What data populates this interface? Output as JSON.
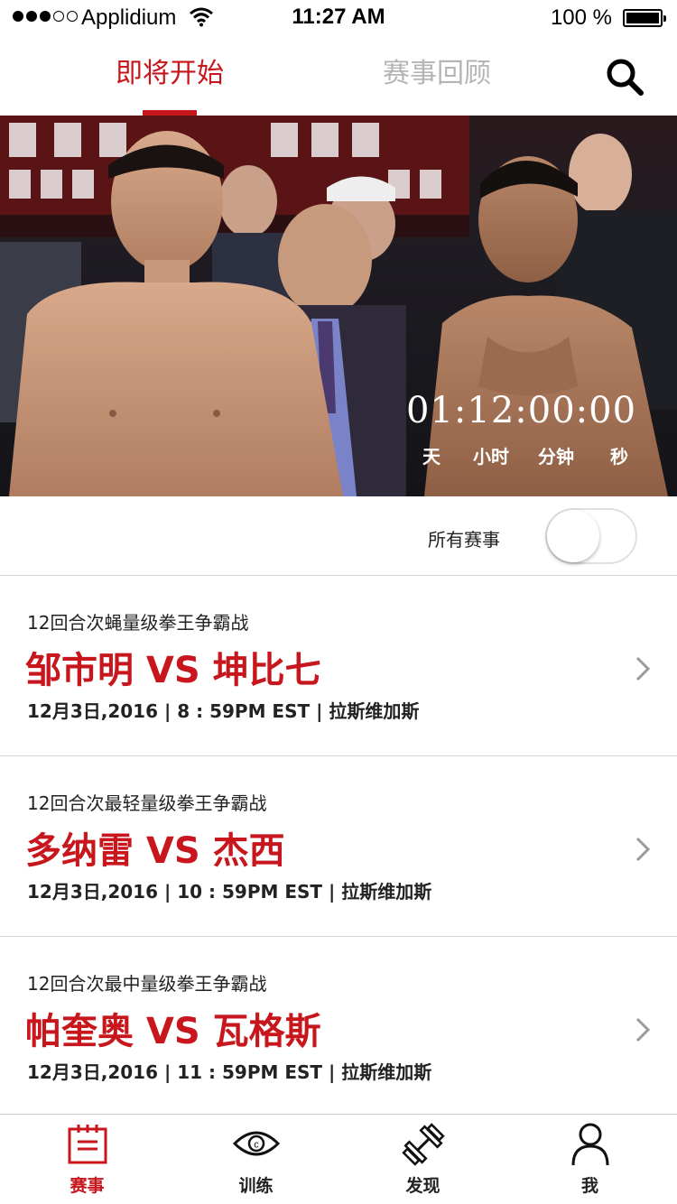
{
  "status_bar": {
    "carrier": "Applidium",
    "time": "11:27 AM",
    "battery": "100 %"
  },
  "tabs": [
    {
      "label": "即将开始",
      "active": true
    },
    {
      "label": "赛事回顾",
      "active": false
    }
  ],
  "hero": {
    "countdown": "01:12:00:00",
    "units": [
      "天",
      "小时",
      "分钟",
      "秒"
    ]
  },
  "filter": {
    "label": "所有赛事",
    "all_events_on": false
  },
  "events": [
    {
      "subtitle": "12回合次蝇量级拳王争霸战",
      "title": "邹市明 VS 坤比七",
      "meta": "12月3日,2016 | 8 : 59PM EST | 拉斯维加斯"
    },
    {
      "subtitle": "12回合次最轻量级拳王争霸战",
      "title": "多纳雷 VS 杰西",
      "meta": "12月3日,2016 | 10 : 59PM EST | 拉斯维加斯"
    },
    {
      "subtitle": "12回合次最中量级拳王争霸战",
      "title": "帕奎奥 VS 瓦格斯",
      "meta": "12月3日,2016 | 11 : 59PM EST | 拉斯维加斯"
    }
  ],
  "bottom_nav": [
    {
      "label": "赛事",
      "icon": "calendar-list-icon",
      "active": true
    },
    {
      "label": "训练",
      "icon": "eye-icon",
      "active": false
    },
    {
      "label": "发现",
      "icon": "dumbbell-icon",
      "active": false
    },
    {
      "label": "我",
      "icon": "person-icon",
      "active": false
    }
  ],
  "colors": {
    "accent": "#c8161d",
    "inactive_tab": "#b4b4b4",
    "divider": "#d8d8d8"
  }
}
